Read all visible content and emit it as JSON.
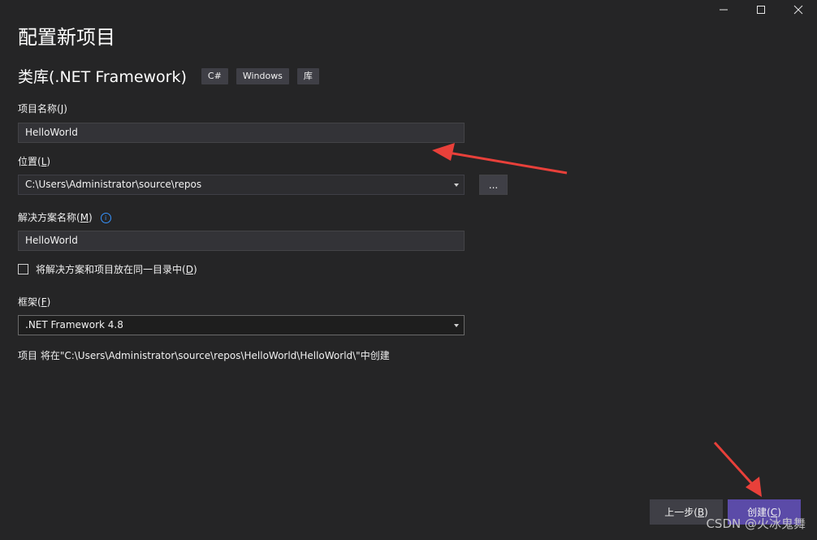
{
  "window": {
    "minimize_glyph": "—",
    "maximize_glyph": "☐",
    "close_glyph": "✕"
  },
  "header": {
    "title": "配置新项目",
    "template_name": "类库(.NET Framework)",
    "tags": [
      "C#",
      "Windows",
      "库"
    ]
  },
  "form": {
    "project_name": {
      "label_pre": "项目名称(",
      "label_key": "J",
      "label_post": ")",
      "value": "HelloWorld"
    },
    "location": {
      "label_pre": "位置(",
      "label_key": "L",
      "label_post": ")",
      "value": "C:\\Users\\Administrator\\source\\repos",
      "browse_label": "..."
    },
    "solution_name": {
      "label_pre": "解决方案名称(",
      "label_key": "M",
      "label_post": ")",
      "value": "HelloWorld",
      "info_glyph": "i"
    },
    "same_dir": {
      "label_pre": "将解决方案和项目放在同一目录中(",
      "label_key": "D",
      "label_post": ")",
      "checked": false
    },
    "framework": {
      "label_pre": "框架(",
      "label_key": "F",
      "label_post": ")",
      "value": ".NET Framework 4.8"
    },
    "path_note": "项目 将在\"C:\\Users\\Administrator\\source\\repos\\HelloWorld\\HelloWorld\\\"中创建"
  },
  "footer": {
    "back_label_pre": "上一步(",
    "back_key": "B",
    "back_label_post": ")",
    "create_label_pre": "创建(",
    "create_key": "C",
    "create_label_post": ")"
  },
  "watermark": "CSDN @火冰鬼舞",
  "colors": {
    "background": "#252526",
    "create_button": "#5b4ba8",
    "annotation_arrow": "#e8403a"
  }
}
